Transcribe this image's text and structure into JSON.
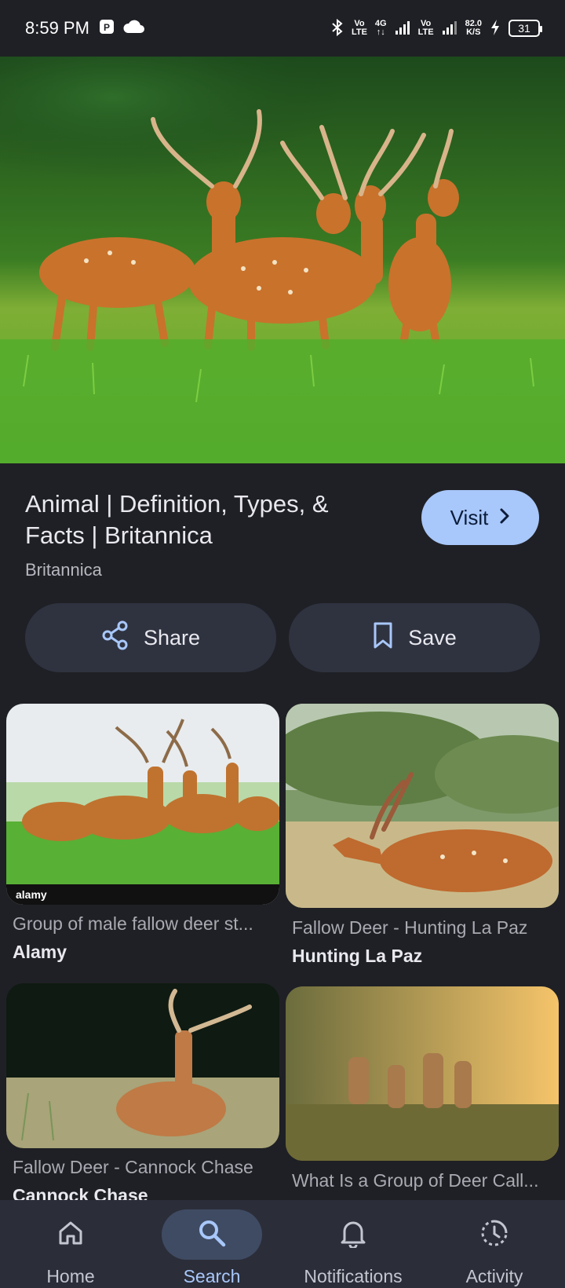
{
  "status_bar": {
    "time": "8:59 PM",
    "net_speed_value": "82.0",
    "net_speed_unit": "K/S",
    "battery": "31",
    "volte1_top": "Vo",
    "volte1_bottom": "LTE",
    "net_4g": "4G",
    "volte2_top": "Vo",
    "volte2_bottom": "LTE"
  },
  "result": {
    "title": "Animal | Definition, Types, & Facts | Britannica",
    "source": "Britannica",
    "visit_label": "Visit",
    "share_label": "Share",
    "save_label": "Save"
  },
  "related": [
    {
      "caption": "Group of male fallow deer st...",
      "source": "Alamy",
      "watermark": "alamy"
    },
    {
      "caption": "Fallow Deer - Hunting La Paz",
      "source": "Hunting La Paz"
    },
    {
      "caption": "Fallow Deer - Cannock Chase",
      "source": "Cannock Chase"
    },
    {
      "caption": "What Is a Group of Deer Call...",
      "source": ""
    }
  ],
  "bottom_nav": {
    "items": [
      {
        "label": "Home",
        "icon": "home-icon"
      },
      {
        "label": "Search",
        "icon": "search-icon",
        "active": true
      },
      {
        "label": "Notifications",
        "icon": "bell-icon"
      },
      {
        "label": "Activity",
        "icon": "activity-icon"
      }
    ]
  },
  "colors": {
    "background": "#1f2025",
    "accent": "#a8c7fa",
    "chip": "#2f3340",
    "nav_bar": "#2b2e39"
  }
}
